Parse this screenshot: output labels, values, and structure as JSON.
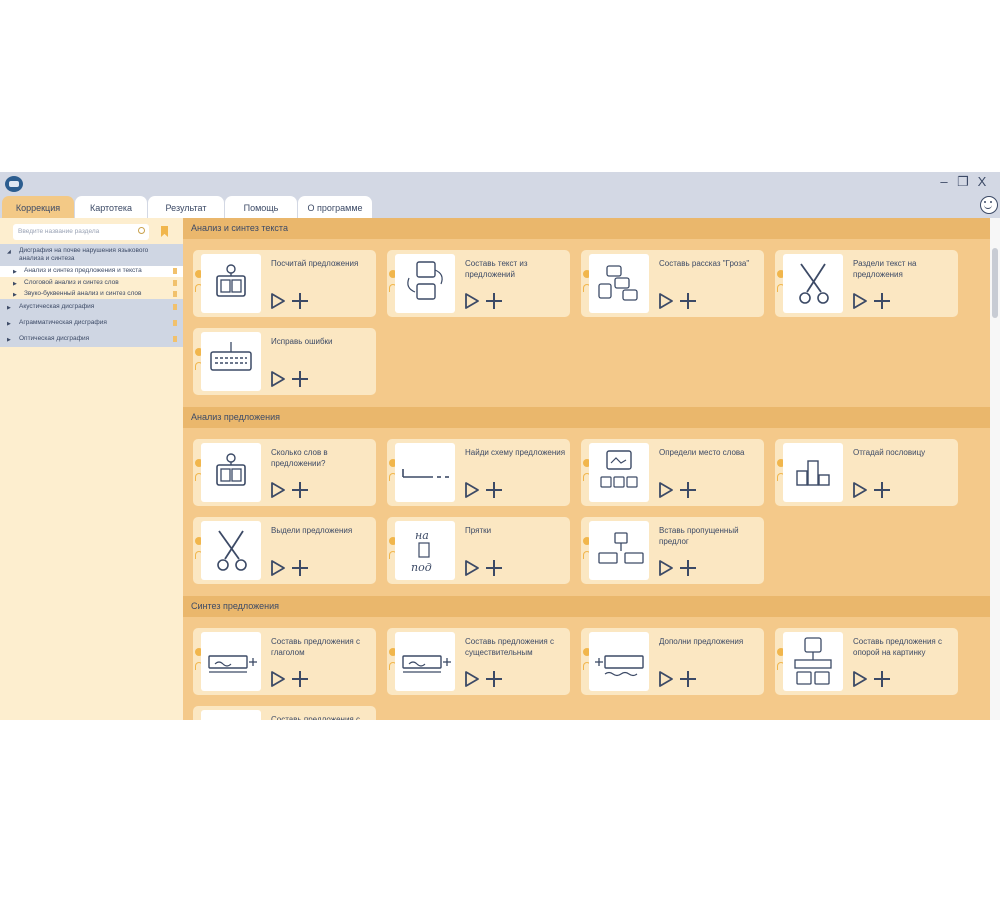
{
  "window": {
    "minimize_icon": "–",
    "restore_icon": "❐",
    "close_icon": "X"
  },
  "tabs": [
    {
      "label": "Коррекция",
      "active": true
    },
    {
      "label": "Картотека",
      "active": false
    },
    {
      "label": "Результат",
      "active": false
    },
    {
      "label": "Помощь",
      "active": false
    },
    {
      "label": "О программе",
      "active": false
    }
  ],
  "sidebar": {
    "search_placeholder": "Введите название раздела",
    "tree": [
      {
        "label": "Дисграфия на почве нарушения языкового анализа и синтеза",
        "level": 0,
        "expanded": true
      },
      {
        "label": "Анализ и синтез предложения и текста",
        "level": 1,
        "selected": true
      },
      {
        "label": "Слоговой анализ и синтез слов",
        "level": 1
      },
      {
        "label": "Звуко-буквенный анализ и синтез слов",
        "level": 1
      },
      {
        "label": "Акустическая дисграфия",
        "level": 0
      },
      {
        "label": "Аграмматическая дисграфия",
        "level": 0
      },
      {
        "label": "Оптическая дисграфия",
        "level": 0
      }
    ]
  },
  "sections": [
    {
      "title": "Анализ и синтез текста",
      "cards": [
        {
          "title": "Посчитай предложения",
          "icon": "counter-icon"
        },
        {
          "title": "Составь текст из предложений",
          "icon": "story-cards-icon"
        },
        {
          "title": "Составь рассказ \"Гроза\"",
          "icon": "numbered-cards-icon"
        },
        {
          "title": "Раздели текст на предложения",
          "icon": "scissors-icon"
        },
        {
          "title": "Исправь ошибки",
          "icon": "keyboard-icon"
        }
      ]
    },
    {
      "title": "Анализ предложения",
      "cards": [
        {
          "title": "Сколько слов в предложении?",
          "icon": "counter-icon"
        },
        {
          "title": "Найди схему предложения",
          "icon": "scheme-icon"
        },
        {
          "title": "Определи место слова",
          "icon": "picture-numbers-icon"
        },
        {
          "title": "Отгадай пословицу",
          "icon": "podium-icon"
        },
        {
          "title": "Выдели предложения",
          "icon": "scissors-icon"
        },
        {
          "title": "Прятки",
          "icon": "prepositions-icon"
        },
        {
          "title": "Вставь пропущенный предлог",
          "icon": "missing-word-icon"
        }
      ]
    },
    {
      "title": "Синтез предложения",
      "cards": [
        {
          "title": "Составь предложения с глаголом",
          "icon": "sentence-verb-icon"
        },
        {
          "title": "Составь предложения с существительным",
          "icon": "sentence-noun-icon"
        },
        {
          "title": "Дополни предложения",
          "icon": "complete-sentence-icon"
        },
        {
          "title": "Составь предложения с опорой на картинку",
          "icon": "picture-puzzle-icon"
        },
        {
          "title": "Составь предложения с",
          "icon": "sentence-icon"
        }
      ]
    }
  ],
  "colors": {
    "accent": "#f1b64c",
    "header": "#eab76c",
    "panel": "#f4c98a",
    "card": "#fbe7c2",
    "text": "#3c4a66",
    "tabbar": "#d3d8e4"
  }
}
